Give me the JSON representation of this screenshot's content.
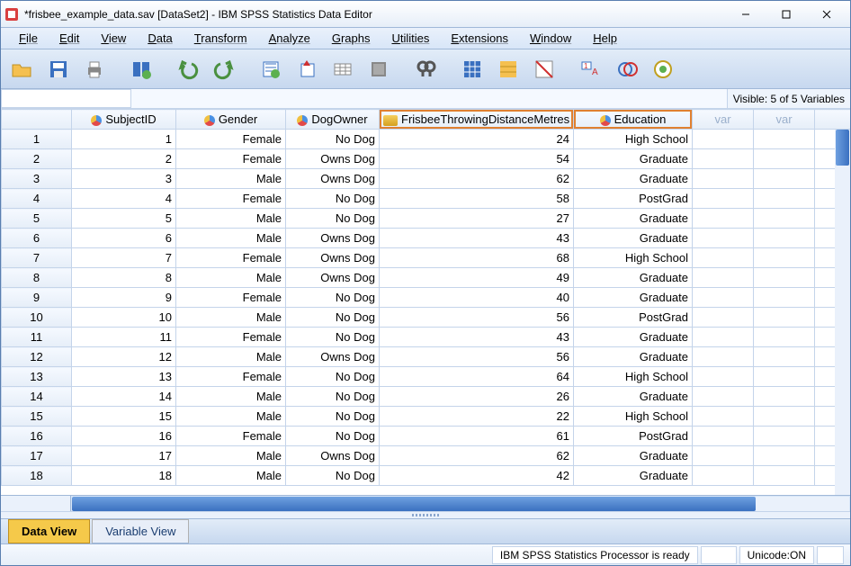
{
  "window": {
    "title": "*frisbee_example_data.sav [DataSet2] - IBM SPSS Statistics Data Editor"
  },
  "menu": [
    "File",
    "Edit",
    "View",
    "Data",
    "Transform",
    "Analyze",
    "Graphs",
    "Utilities",
    "Extensions",
    "Window",
    "Help"
  ],
  "visible_label": "Visible: 5 of 5 Variables",
  "columns": {
    "c1": "SubjectID",
    "c2": "Gender",
    "c3": "DogOwner",
    "c4": "FrisbeeThrowingDistanceMetres",
    "c5": "Education",
    "empty": "var"
  },
  "rows": [
    {
      "n": "1",
      "id": "1",
      "g": "Female",
      "d": "No Dog",
      "f": "24",
      "e": "High School"
    },
    {
      "n": "2",
      "id": "2",
      "g": "Female",
      "d": "Owns Dog",
      "f": "54",
      "e": "Graduate"
    },
    {
      "n": "3",
      "id": "3",
      "g": "Male",
      "d": "Owns Dog",
      "f": "62",
      "e": "Graduate"
    },
    {
      "n": "4",
      "id": "4",
      "g": "Female",
      "d": "No Dog",
      "f": "58",
      "e": "PostGrad"
    },
    {
      "n": "5",
      "id": "5",
      "g": "Male",
      "d": "No Dog",
      "f": "27",
      "e": "Graduate"
    },
    {
      "n": "6",
      "id": "6",
      "g": "Male",
      "d": "Owns Dog",
      "f": "43",
      "e": "Graduate"
    },
    {
      "n": "7",
      "id": "7",
      "g": "Female",
      "d": "Owns Dog",
      "f": "68",
      "e": "High School"
    },
    {
      "n": "8",
      "id": "8",
      "g": "Male",
      "d": "Owns Dog",
      "f": "49",
      "e": "Graduate"
    },
    {
      "n": "9",
      "id": "9",
      "g": "Female",
      "d": "No Dog",
      "f": "40",
      "e": "Graduate"
    },
    {
      "n": "10",
      "id": "10",
      "g": "Male",
      "d": "No Dog",
      "f": "56",
      "e": "PostGrad"
    },
    {
      "n": "11",
      "id": "11",
      "g": "Female",
      "d": "No Dog",
      "f": "43",
      "e": "Graduate"
    },
    {
      "n": "12",
      "id": "12",
      "g": "Male",
      "d": "Owns Dog",
      "f": "56",
      "e": "Graduate"
    },
    {
      "n": "13",
      "id": "13",
      "g": "Female",
      "d": "No Dog",
      "f": "64",
      "e": "High School"
    },
    {
      "n": "14",
      "id": "14",
      "g": "Male",
      "d": "No Dog",
      "f": "26",
      "e": "Graduate"
    },
    {
      "n": "15",
      "id": "15",
      "g": "Male",
      "d": "No Dog",
      "f": "22",
      "e": "High School"
    },
    {
      "n": "16",
      "id": "16",
      "g": "Female",
      "d": "No Dog",
      "f": "61",
      "e": "PostGrad"
    },
    {
      "n": "17",
      "id": "17",
      "g": "Male",
      "d": "Owns Dog",
      "f": "62",
      "e": "Graduate"
    },
    {
      "n": "18",
      "id": "18",
      "g": "Male",
      "d": "No Dog",
      "f": "42",
      "e": "Graduate"
    }
  ],
  "tabs": {
    "data": "Data View",
    "variable": "Variable View"
  },
  "status": {
    "processor": "IBM SPSS Statistics Processor is ready",
    "unicode": "Unicode:ON"
  }
}
